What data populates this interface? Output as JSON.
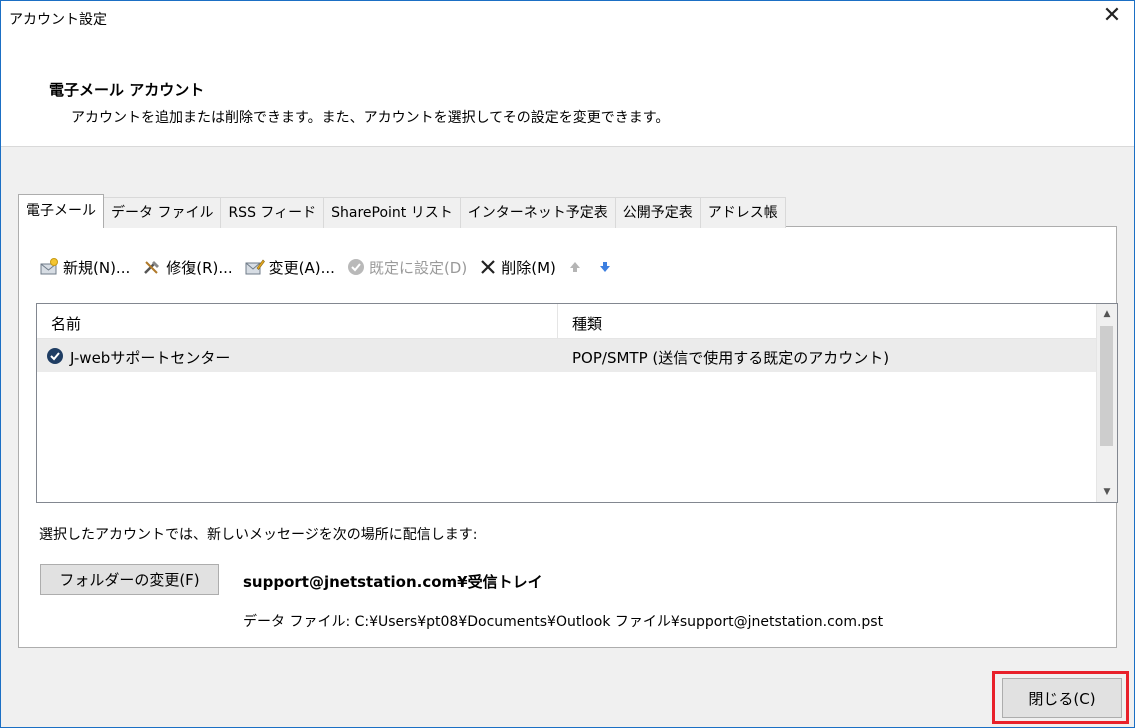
{
  "window": {
    "title": "アカウント設定",
    "close_glyph": "✕"
  },
  "header": {
    "title": "電子メール アカウント",
    "description": "アカウントを追加または削除できます。また、アカウントを選択してその設定を変更できます。"
  },
  "tabs": [
    {
      "label": "電子メール",
      "active": true
    },
    {
      "label": "データ ファイル",
      "active": false
    },
    {
      "label": "RSS フィード",
      "active": false
    },
    {
      "label": "SharePoint リスト",
      "active": false
    },
    {
      "label": "インターネット予定表",
      "active": false
    },
    {
      "label": "公開予定表",
      "active": false
    },
    {
      "label": "アドレス帳",
      "active": false
    }
  ],
  "toolbar": {
    "new_label": "新規(N)...",
    "repair_label": "修復(R)...",
    "change_label": "変更(A)...",
    "set_default_label": "既定に設定(D)",
    "delete_label": "削除(M)",
    "icons": {
      "new": "new-account-icon",
      "repair": "repair-tools-icon",
      "change": "change-account-icon",
      "set_default": "check-circle-icon",
      "delete": "x-icon",
      "up": "arrow-up-icon",
      "down": "arrow-down-icon"
    }
  },
  "accounts_list": {
    "columns": [
      "名前",
      "種類"
    ],
    "rows": [
      {
        "name": "J-webサポートセンター",
        "type": "POP/SMTP (送信で使用する既定のアカウント)",
        "default": true
      }
    ]
  },
  "delivery": {
    "text": "選択したアカウントでは、新しいメッセージを次の場所に配信します:",
    "change_folder_label": "フォルダーの変更(F)",
    "location": "support@jnetstation.com¥受信トレイ",
    "data_file_line": "データ ファイル: C:¥Users¥pt08¥Documents¥Outlook ファイル¥support@jnetstation.com.pst"
  },
  "footer": {
    "close_label": "閉じる(C)"
  },
  "colors": {
    "accent": "#1b6fc4",
    "highlight": "#e8202a"
  }
}
